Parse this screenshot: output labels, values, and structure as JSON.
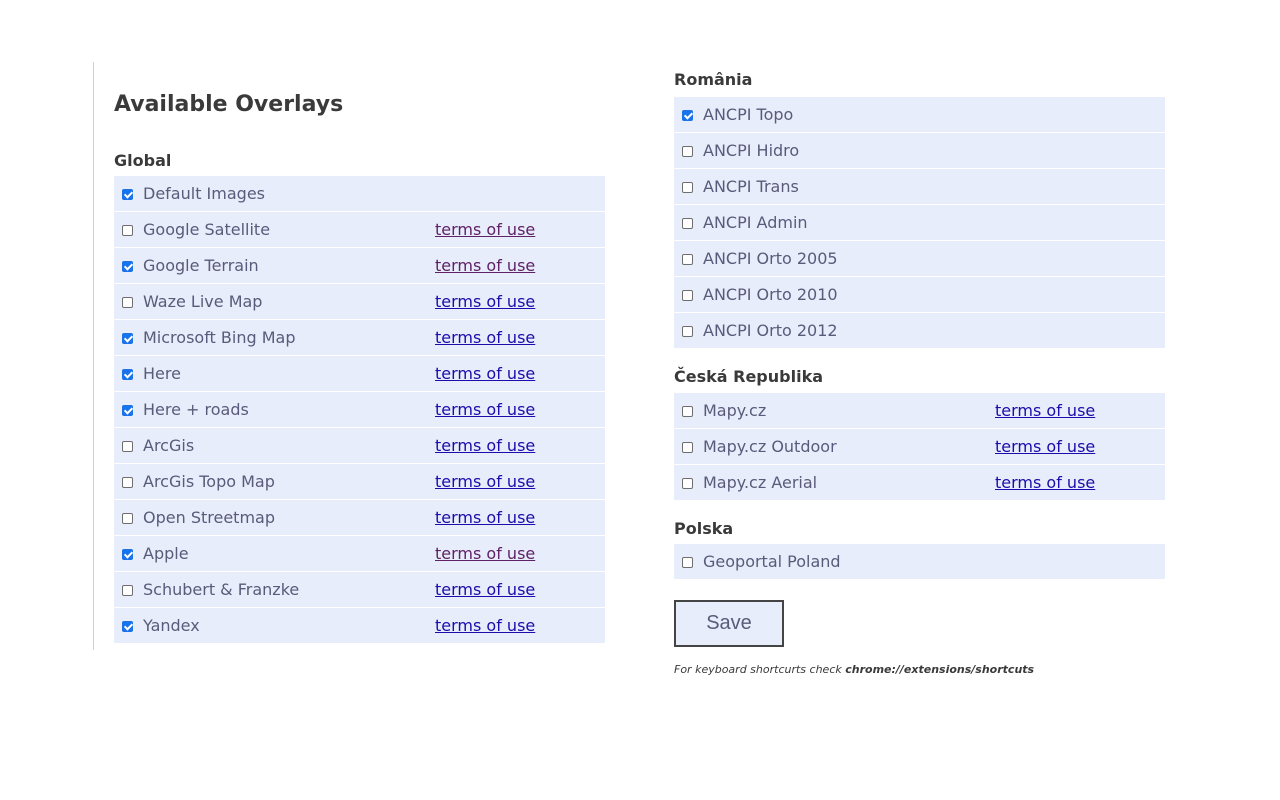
{
  "page": {
    "title": "Available Overlays",
    "save_label": "Save",
    "footnote_prefix": "For keyboard shortcurts check",
    "footnote_link": "chrome://extensions/shortcuts"
  },
  "colors": {
    "row_background": "#e8edfb",
    "checkbox_checked": "#1a73e8",
    "link": "#1a0dab",
    "link_visited": "#5f2167"
  },
  "global": {
    "title": "Global",
    "items": [
      {
        "label": "Default Images",
        "checked": true,
        "terms": null
      },
      {
        "label": "Google Satellite",
        "checked": false,
        "terms": "terms of use",
        "visited": true
      },
      {
        "label": "Google Terrain",
        "checked": true,
        "terms": "terms of use",
        "visited": true
      },
      {
        "label": "Waze Live Map",
        "checked": false,
        "terms": "terms of use"
      },
      {
        "label": "Microsoft Bing Map",
        "checked": true,
        "terms": "terms of use"
      },
      {
        "label": "Here",
        "checked": true,
        "terms": "terms of use"
      },
      {
        "label": "Here + roads",
        "checked": true,
        "terms": "terms of use"
      },
      {
        "label": "ArcGis",
        "checked": false,
        "terms": "terms of use"
      },
      {
        "label": "ArcGis Topo Map",
        "checked": false,
        "terms": "terms of use"
      },
      {
        "label": "Open Streetmap",
        "checked": false,
        "terms": "terms of use"
      },
      {
        "label": "Apple",
        "checked": true,
        "terms": "terms of use",
        "visited": true
      },
      {
        "label": "Schubert & Franzke",
        "checked": false,
        "terms": "terms of use"
      },
      {
        "label": "Yandex",
        "checked": true,
        "terms": "terms of use"
      }
    ]
  },
  "romania": {
    "title": "România",
    "items": [
      {
        "label": "ANCPI Topo",
        "checked": true
      },
      {
        "label": "ANCPI Hidro",
        "checked": false
      },
      {
        "label": "ANCPI Trans",
        "checked": false
      },
      {
        "label": "ANCPI Admin",
        "checked": false
      },
      {
        "label": "ANCPI Orto 2005",
        "checked": false
      },
      {
        "label": "ANCPI Orto 2010",
        "checked": false
      },
      {
        "label": "ANCPI Orto 2012",
        "checked": false
      }
    ]
  },
  "czech": {
    "title": "Česká Republika",
    "items": [
      {
        "label": "Mapy.cz",
        "checked": false,
        "terms": "terms of use"
      },
      {
        "label": "Mapy.cz Outdoor",
        "checked": false,
        "terms": "terms of use"
      },
      {
        "label": "Mapy.cz Aerial",
        "checked": false,
        "terms": "terms of use"
      }
    ]
  },
  "polska": {
    "title": "Polska",
    "items": [
      {
        "label": "Geoportal Poland",
        "checked": false
      }
    ]
  }
}
